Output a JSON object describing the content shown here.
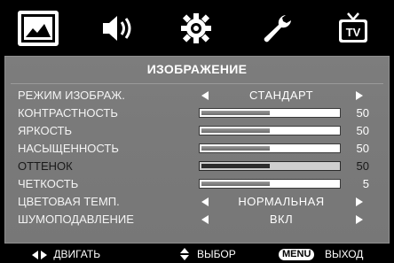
{
  "tabs": [
    {
      "icon": "picture-icon",
      "active": true
    },
    {
      "icon": "sound-icon",
      "active": false
    },
    {
      "icon": "settings-gear-icon",
      "active": false
    },
    {
      "icon": "wrench-icon",
      "active": false
    },
    {
      "icon": "tv-icon",
      "active": false
    }
  ],
  "menu": {
    "title": "ИЗОБРАЖЕНИЕ",
    "rows": [
      {
        "label": "РЕЖИМ ИЗОБРАЖ.",
        "type": "option",
        "value": "СТАНДАРТ"
      },
      {
        "label": "КОНТРАСТНОСТЬ",
        "type": "slider",
        "value": "50",
        "level": 50
      },
      {
        "label": "ЯРКОСТЬ",
        "type": "slider",
        "value": "50",
        "level": 50
      },
      {
        "label": "НАСЫЩЕННОСТЬ",
        "type": "slider",
        "value": "50",
        "level": 50
      },
      {
        "label": "ОТТЕНОК",
        "type": "slider",
        "value": "50",
        "level": 50,
        "selected": true
      },
      {
        "label": "ЧЕТКОСТЬ",
        "type": "slider",
        "value": "5",
        "level": 50
      },
      {
        "label": "ЦВЕТОВАЯ ТЕМП.",
        "type": "option",
        "value": "НОРМАЛЬНАЯ"
      },
      {
        "label": "ШУМОПОДАВЛЕНИЕ",
        "type": "option",
        "value": "ВКЛ"
      }
    ]
  },
  "help": {
    "move_label": "ДВИГАТЬ",
    "select_label": "ВЫБОР",
    "menu_key": "MENU",
    "exit_label": "ВЫХОД"
  },
  "colors": {
    "panel": "#7b7b7b",
    "slider_fill": "#7a7a7a",
    "selected_fill": "#2c2c2c"
  }
}
